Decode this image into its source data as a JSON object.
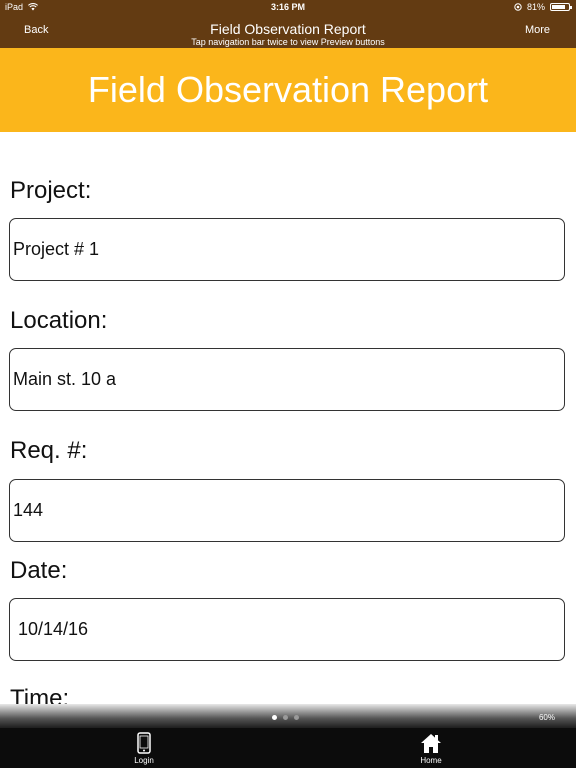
{
  "status_bar": {
    "carrier": "iPad",
    "time": "3:16 PM",
    "battery": "81%",
    "battery_level": 0.81,
    "icons": [
      "wifi-icon",
      "location-icon",
      "battery-icon"
    ]
  },
  "nav": {
    "back_label": "Back",
    "title": "Field Observation Report",
    "subtitle": "Tap navigation bar twice to view Preview buttons",
    "more_label": "More"
  },
  "banner": {
    "title": "Field Observation Report"
  },
  "form": {
    "project_label": "Project:",
    "project_value": "Project # 1",
    "location_label": "Location:",
    "location_value": "Main st. 10 a",
    "req_label": "Req. #:",
    "req_value": "144",
    "date_label": "Date:",
    "date_value": "10/14/16",
    "time_label": "Time:"
  },
  "pager": {
    "pages": 3,
    "current": 1,
    "zoom": "60%"
  },
  "tabbar": {
    "login_label": "Login",
    "home_label": "Home"
  },
  "colors": {
    "nav_brown": "#633b12",
    "banner_yellow": "#fbb61b",
    "tabbar_black": "#0c0c0c"
  }
}
